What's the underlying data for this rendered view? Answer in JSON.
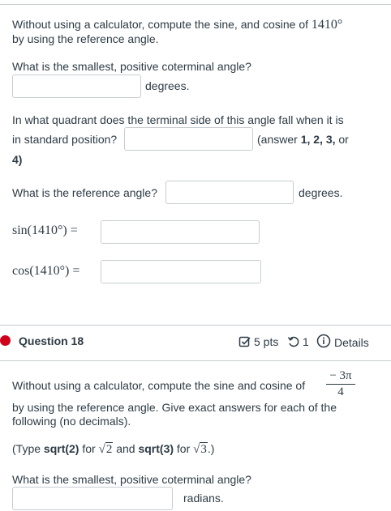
{
  "q17": {
    "intro_line1": "Without using a calculator, compute the sine, and cosine of",
    "intro_angle": "1410°",
    "intro_line2": "by using the reference angle.",
    "coterminal_prompt": "What is the smallest, positive coterminal angle?",
    "coterminal_unit": "degrees.",
    "quadrant_prompt_line1": "In what quadrant does the terminal side of this angle fall when it is",
    "quadrant_prompt_line2": "in standard position?",
    "quadrant_hint_pre": "(answer",
    "quadrant_hint_nums": "1, 2, 3,",
    "quadrant_hint_or": "or",
    "quadrant_hint_last": "4)",
    "reference_prompt": "What is the reference angle?",
    "reference_unit": "degrees.",
    "sin_label": "sin(1410°) =",
    "cos_label": "cos(1410°) ="
  },
  "q18": {
    "title": "Question 18",
    "points": "5 pts",
    "attempts": "1",
    "details": "Details",
    "intro_line1": "Without using a calculator, compute the sine and cosine of",
    "frac_num": "− 3π",
    "frac_den": "4",
    "intro_line2": "by using the reference angle. Give exact answers for each of the",
    "intro_line3": "following (no decimals).",
    "type_pre": "(Type",
    "type_sqrt2": "sqrt(2)",
    "type_for": "for",
    "type_rad2": "2",
    "type_and": "and",
    "type_sqrt3": "sqrt(3)",
    "type_for2": "for",
    "type_rad3": "3",
    "type_end": ".)",
    "coterminal_prompt": "What is the smallest, positive coterminal angle?",
    "coterminal_unit": "radians."
  },
  "colors": {
    "status_dot": "#d0021b",
    "border": "#c7cdd1",
    "text": "#2d3b45"
  }
}
